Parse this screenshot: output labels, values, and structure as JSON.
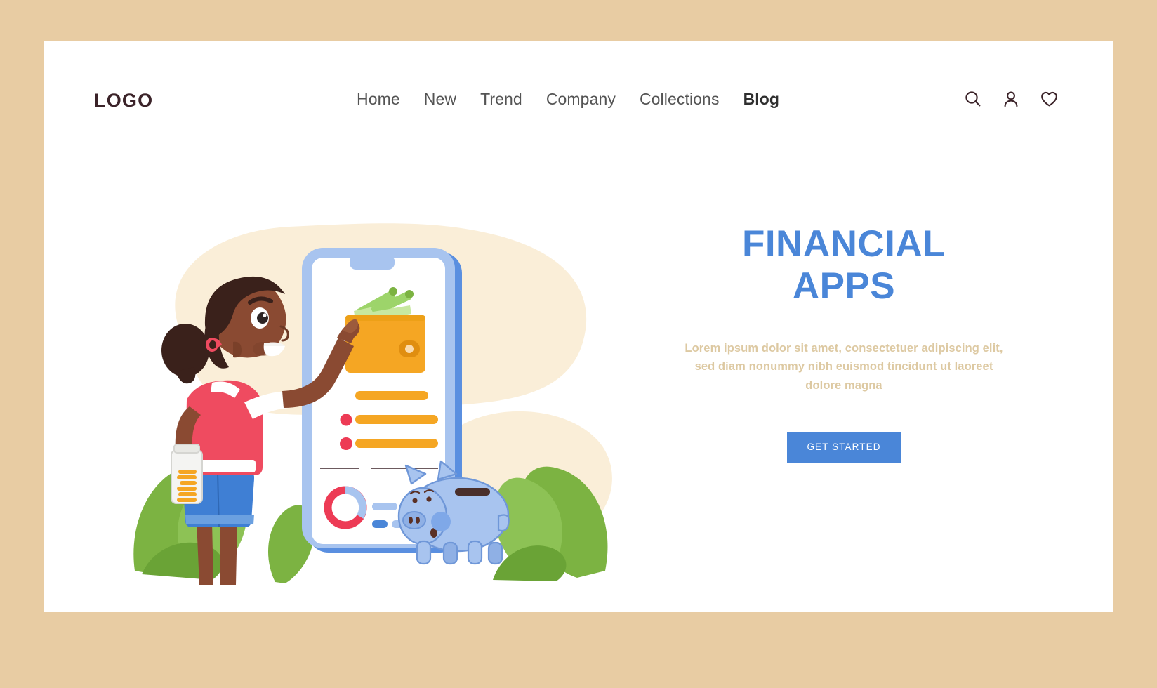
{
  "header": {
    "logo": "LOGO",
    "nav": [
      {
        "label": "Home",
        "active": false
      },
      {
        "label": "New",
        "active": false
      },
      {
        "label": "Trend",
        "active": false
      },
      {
        "label": "Company",
        "active": false
      },
      {
        "label": "Collections",
        "active": false
      },
      {
        "label": "Blog",
        "active": true
      }
    ],
    "icons": [
      {
        "name": "search-icon"
      },
      {
        "name": "user-icon"
      },
      {
        "name": "heart-icon"
      }
    ]
  },
  "hero": {
    "title_line1": "FINANCIAL",
    "title_line2": "APPS",
    "description": "Lorem ipsum dolor sit amet, consectetuer adipiscing elit, sed diam nonummy nibh euismod tincidunt ut laoreet dolore magna",
    "cta_label": "GET STARTED"
  },
  "illustration": {
    "alt": "Girl pointing at a giant smartphone showing a finance app, with a piggy bank and plants",
    "phone_screen": {
      "wallet": "orange-wallet-with-cash",
      "list_rows": 3,
      "chart": "donut-chart"
    },
    "characters": [
      "girl-with-coin-jar",
      "piggy-bank"
    ]
  },
  "colors": {
    "page_border": "#e8cca3",
    "card_background": "#ffffff",
    "accent_blue": "#4a86d8",
    "muted_tan_text": "#ddc9a2",
    "logo_dark": "#3b2329",
    "nav_gray": "#545454",
    "blob_cream": "#faeed8",
    "orange": "#f5a623",
    "leaf_green": "#7cb342",
    "pink_red": "#ed3b55",
    "piggy_blue": "#a8c4ef"
  }
}
